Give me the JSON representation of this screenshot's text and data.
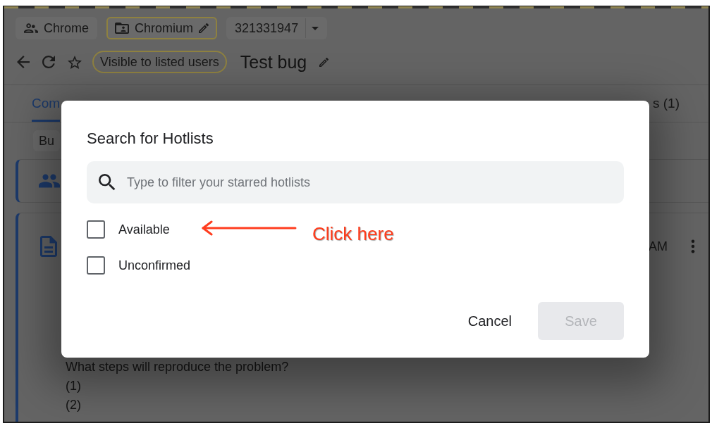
{
  "header": {
    "chips": [
      {
        "kind": "component",
        "label": "Chrome",
        "outlined": false
      },
      {
        "kind": "project",
        "label": "Chromium",
        "outlined": true
      },
      {
        "kind": "issue_id",
        "label": "321331947",
        "outlined": false
      }
    ],
    "access_chip": {
      "label": "Visible to listed users",
      "outlined": true
    },
    "title": "Test bug"
  },
  "tabs": [
    {
      "label": "Com",
      "selected": true
    },
    {
      "label": "s (1)",
      "selected": false
    }
  ],
  "filter_chip": "Bu",
  "comment": {
    "time": "AM",
    "lines": [
      "What steps will reproduce the problem?",
      "(1)",
      "(2)"
    ]
  },
  "dialog": {
    "title": "Search for Hotlists",
    "search": {
      "placeholder": "Type to filter your starred hotlists"
    },
    "options": [
      {
        "label": "Available",
        "checked": false
      },
      {
        "label": "Unconfirmed",
        "checked": false
      }
    ],
    "buttons": [
      {
        "kind": "cancel",
        "label": "Cancel",
        "disabled": false
      },
      {
        "kind": "save",
        "label": "Save",
        "disabled": true
      }
    ]
  },
  "annotation": {
    "text": "Click here"
  }
}
